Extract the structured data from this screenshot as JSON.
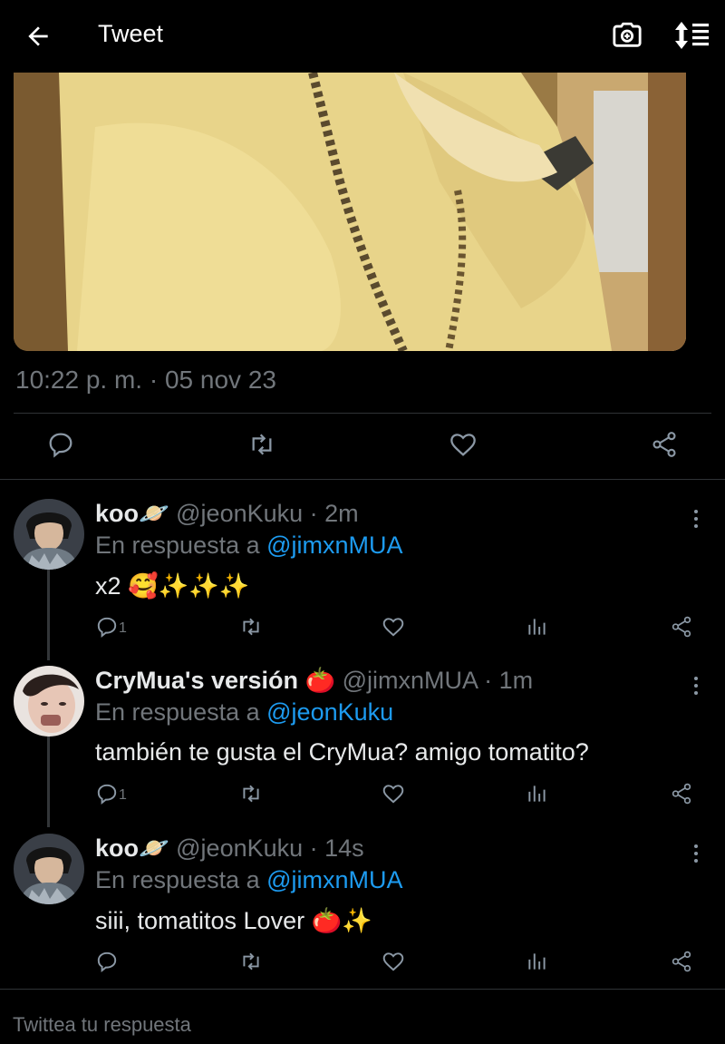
{
  "header": {
    "title": "Tweet",
    "back_icon": "arrow-left-icon",
    "camera_icon": "camera-icon",
    "sort_icon": "sort-icon"
  },
  "tweet": {
    "timestamp": "10:22 p. m. · 05 nov 23"
  },
  "replies": [
    {
      "name": "koo🪐",
      "handle": "@jeonKuku",
      "time": "· 2m",
      "in_reply_prefix": "En respuesta a",
      "mention": "@jimxnMUA",
      "text": "x2 🥰✨✨✨",
      "reply_count": "1"
    },
    {
      "name": "CryMua's versión 🍅",
      "handle": "@jimxnMUA",
      "time": "· 1m",
      "in_reply_prefix": "En respuesta a",
      "mention": "@jeonKuku",
      "text": "también te gusta el CryMua? amigo tomatito?",
      "reply_count": "1"
    },
    {
      "name": "koo🪐",
      "handle": "@jeonKuku",
      "time": "· 14s",
      "in_reply_prefix": "En respuesta a",
      "mention": "@jimxnMUA",
      "text": "siii, tomatitos Lover 🍅✨",
      "reply_count": ""
    }
  ],
  "compose": {
    "placeholder": "Twittea tu respuesta"
  },
  "colors": {
    "background": "#000000",
    "accent": "#1d9bf0",
    "muted": "#71767b",
    "divider": "#2f3336"
  }
}
